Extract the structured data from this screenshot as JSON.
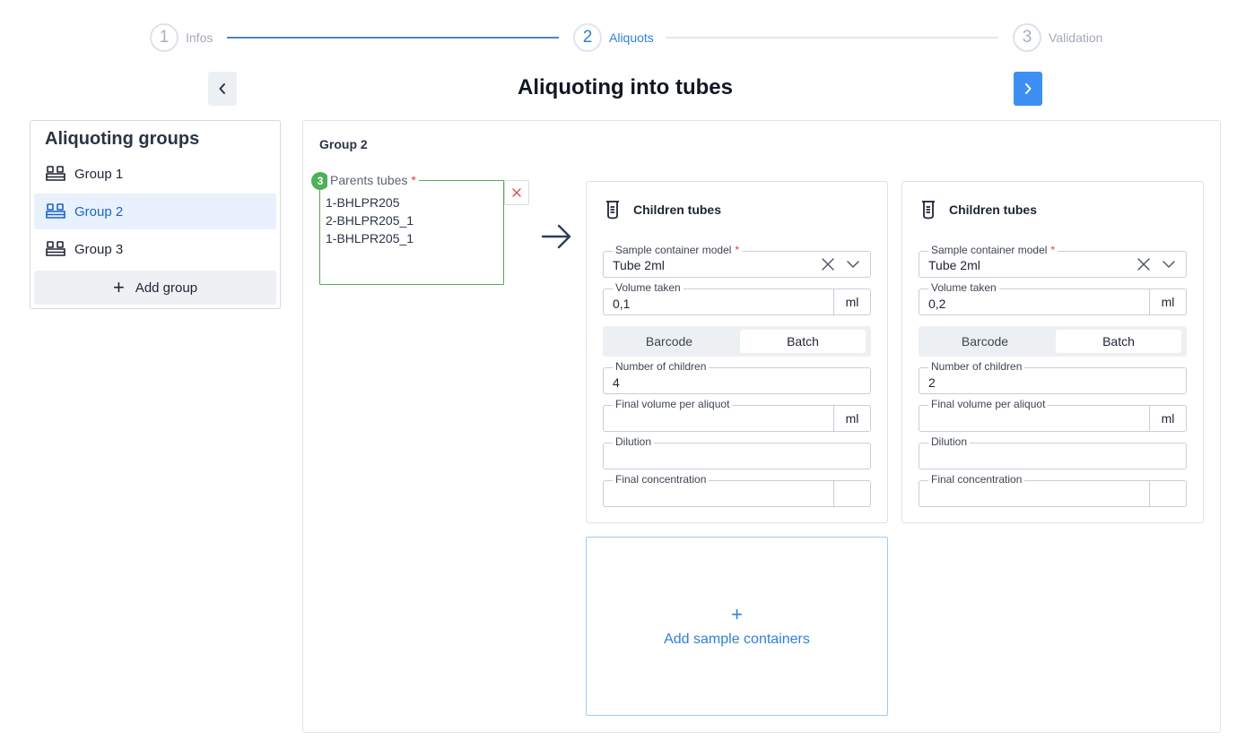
{
  "stepper": {
    "steps": [
      {
        "number": "1",
        "label": "Infos"
      },
      {
        "number": "2",
        "label": "Aliquots"
      },
      {
        "number": "3",
        "label": "Validation"
      }
    ],
    "active_step": 2
  },
  "header": {
    "title": "Aliquoting into tubes",
    "prev_icon": "chevron-left-icon",
    "next_icon": "chevron-right-icon"
  },
  "sidebar": {
    "title": "Aliquoting groups",
    "items": [
      {
        "label": "Group 1",
        "icon": "tube-rack-icon",
        "selected": false
      },
      {
        "label": "Group 2",
        "icon": "tube-rack-icon",
        "selected": true
      },
      {
        "label": "Group 3",
        "icon": "tube-rack-icon",
        "selected": false
      }
    ],
    "add_label": "Add group"
  },
  "main": {
    "group_name": "Group 2",
    "parents": {
      "label": "Parents tubes",
      "required_mark": "*",
      "count": "3",
      "tubes": [
        "1-BHLPR205",
        "2-BHLPR205_1",
        "1-BHLPR205_1"
      ],
      "clear_icon": "close-icon"
    },
    "cards": [
      {
        "title": "Children tubes",
        "container_model_label": "Sample container model",
        "container_model_required": "*",
        "container_model_value": "Tube 2ml",
        "volume_taken_label": "Volume taken",
        "volume_taken_value": "0,1",
        "volume_unit": "ml",
        "mode_options": [
          "Barcode",
          "Batch"
        ],
        "mode_selected": "Batch",
        "children_label": "Number of children",
        "children_value": "4",
        "final_volume_label": "Final volume per aliquot",
        "final_volume_value": "",
        "final_volume_unit": "ml",
        "dilution_label": "Dilution",
        "dilution_value": "",
        "concentration_label": "Final concentration",
        "concentration_value": "",
        "concentration_unit": ""
      },
      {
        "title": "Children tubes",
        "container_model_label": "Sample container model",
        "container_model_required": "*",
        "container_model_value": "Tube 2ml",
        "volume_taken_label": "Volume taken",
        "volume_taken_value": "0,2",
        "volume_unit": "ml",
        "mode_options": [
          "Barcode",
          "Batch"
        ],
        "mode_selected": "Batch",
        "children_label": "Number of children",
        "children_value": "2",
        "final_volume_label": "Final volume per aliquot",
        "final_volume_value": "",
        "final_volume_unit": "ml",
        "dilution_label": "Dilution",
        "dilution_value": "",
        "concentration_label": "Final concentration",
        "concentration_value": "",
        "concentration_unit": ""
      }
    ],
    "add_containers": {
      "plus": "+",
      "label": "Add sample containers"
    }
  },
  "colors": {
    "accent": "#2f80d6",
    "primary_button": "#3d8ff5",
    "selected_bg": "#e8f1fc",
    "valid_border": "#5aaa5a",
    "required": "#e03a3a"
  }
}
